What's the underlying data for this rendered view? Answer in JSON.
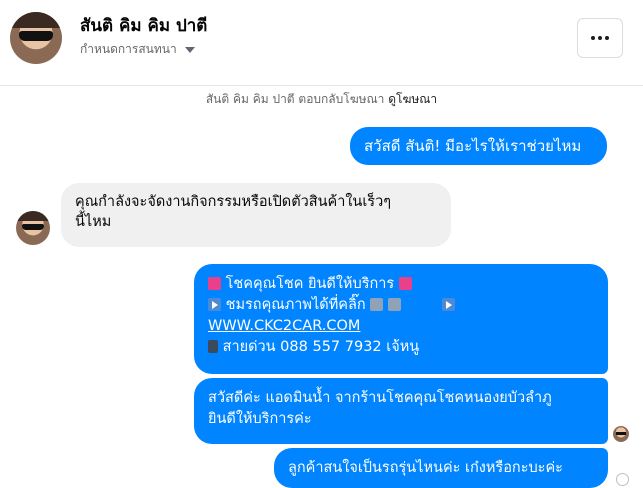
{
  "header": {
    "name": "สันติ คิม คิม ปาตี",
    "subtitle": "กำหนดการสนทนา",
    "more_label": "..."
  },
  "notice": {
    "text": "สันติ คิม คิม ปาตี ตอบกลับโฆษณา",
    "link": "ดูโฆษณา"
  },
  "messages": [
    {
      "from": "page",
      "text": "สวัสดี สันติ! มีอะไรให้เราช่วยไหม"
    },
    {
      "from": "user",
      "line1": "คุณกำลังจะจัดงานกิจกรรมหรือเปิดตัวสินค้าในเร็วๆ",
      "line2": "นี้ไหม"
    },
    {
      "from": "page",
      "line1": "โชคคุณโชค ยินดีให้บริการ",
      "line2": "ชมรถคุณภาพได้ที่คลิ๊ก",
      "line3": "WWW.CKC2CAR.COM",
      "line4": "สายด่วน 088 557 7932 เจ้หนู"
    },
    {
      "from": "page",
      "line1": "สวัสดีค่ะ แอดมินน้ำ จากร้านโชคคุณโชคหนองยบัวลำภู",
      "line2": "ยินดีให้บริการค่ะ"
    },
    {
      "from": "page",
      "text": "ลูกค้าสนใจเป็นรถรุ่นไหนค่ะ เก๋งหรือกะบะค่ะ"
    }
  ],
  "colors": {
    "outgoing": "#0084ff",
    "incoming": "#f0f0f0"
  }
}
